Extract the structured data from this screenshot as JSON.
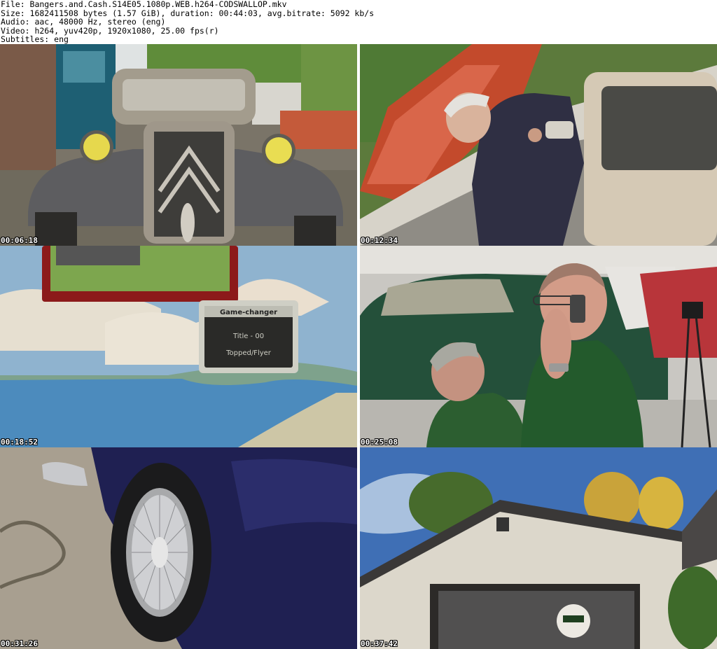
{
  "header": {
    "file_line": "File: Bangers.and.Cash.S14E05.1080p.WEB.h264-CODSWALLOP.mkv",
    "size_line": "Size: 1682411508 bytes (1.57 GiB), duration: 00:44:03, avg.bitrate: 5092 kb/s",
    "audio_line": "Audio: aac, 48000 Hz, stereo (eng)",
    "video_line": "Video: h264, yuv420p, 1920x1080, 25.00 fps(r)",
    "subtitles_line": "Subtitles: eng"
  },
  "thumbnails": [
    {
      "timestamp": "00:06:18",
      "scene": "grey vintage car front with yellow headlights"
    },
    {
      "timestamp": "00:12:34",
      "scene": "man leaning on car transporter with red car"
    },
    {
      "timestamp": "00:18:52",
      "scene": "animated graphic with coastline and sign"
    },
    {
      "timestamp": "00:25:08",
      "scene": "two men in green shirts, one on phone, in car showroom"
    },
    {
      "timestamp": "00:31:26",
      "scene": "close-up of wire wheel on dark blue car"
    },
    {
      "timestamp": "00:37:42",
      "scene": "white garage building under blue sky"
    }
  ],
  "graphic_sign": {
    "title": "Game-changer",
    "line1": "Title - 00",
    "line2": "Topped/Flyer"
  }
}
